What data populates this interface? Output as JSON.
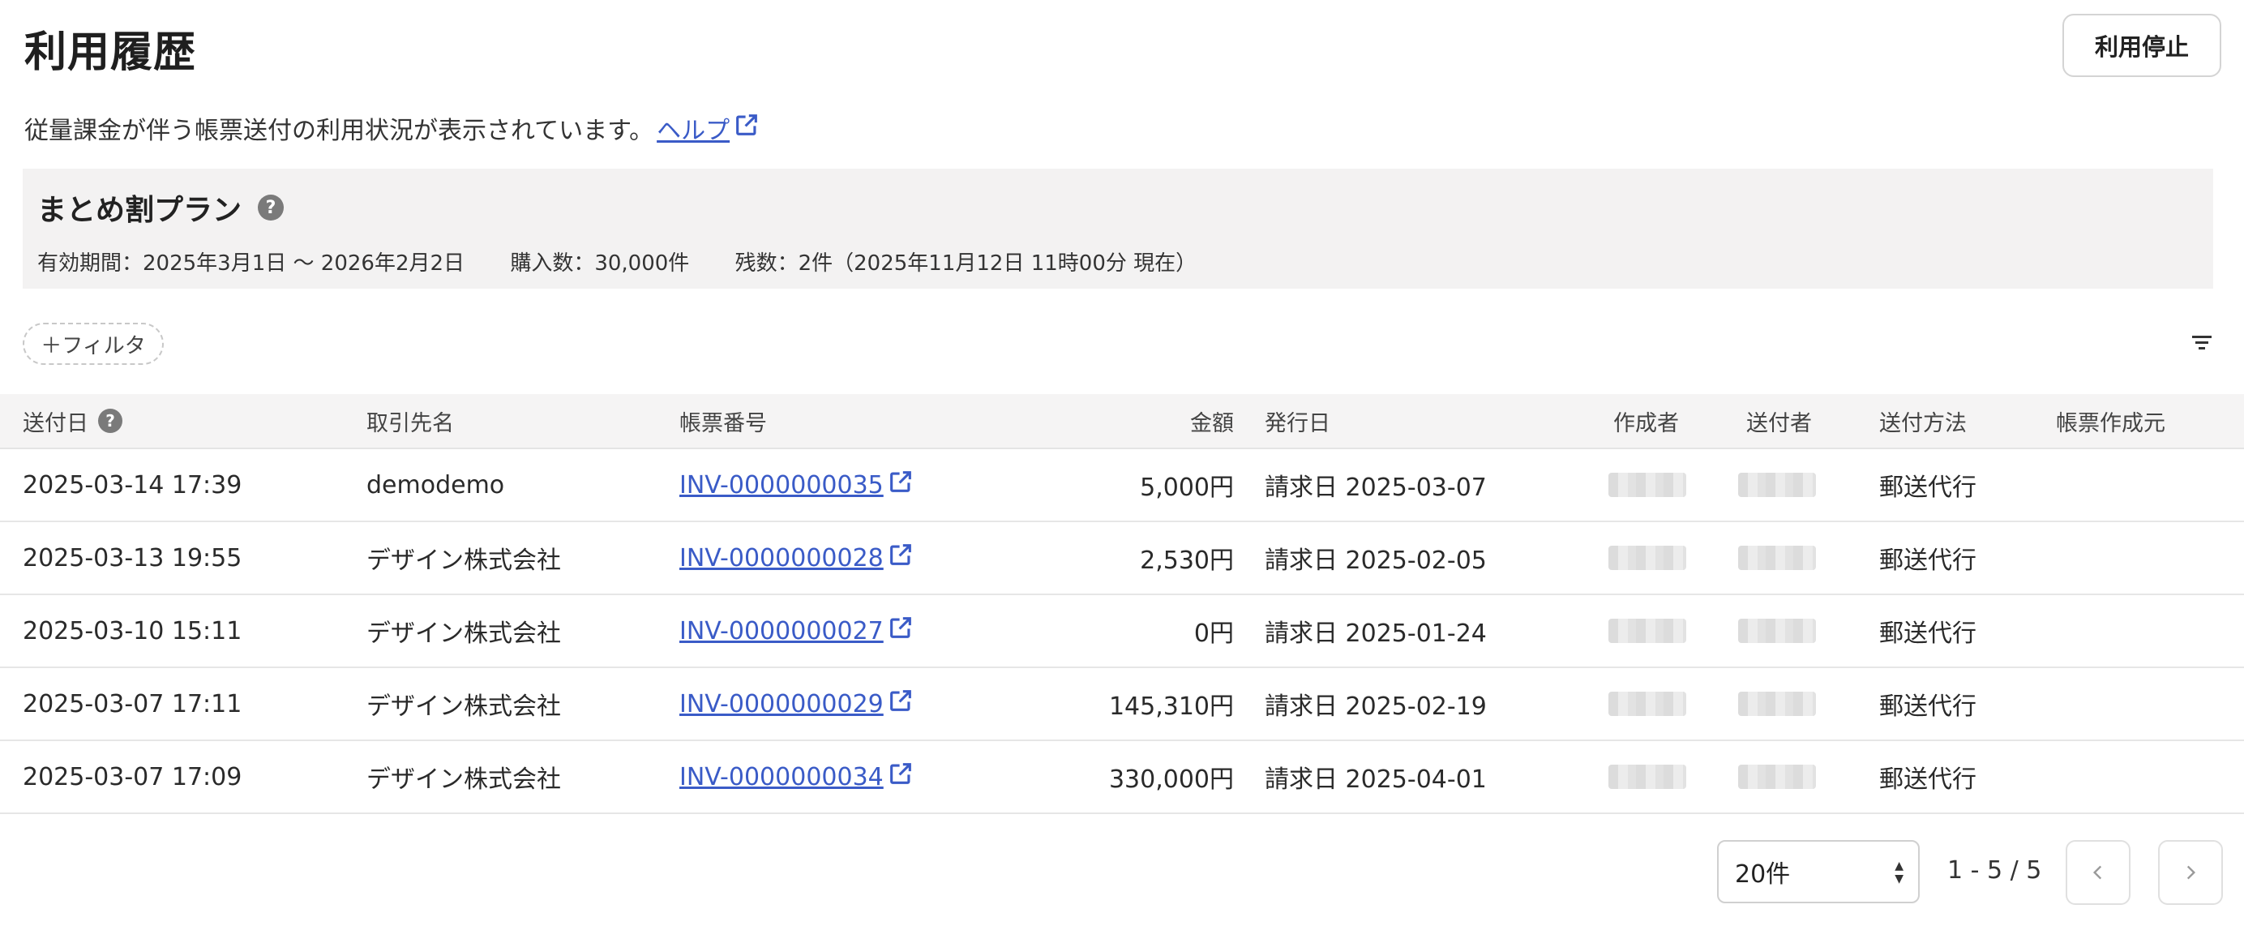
{
  "page": {
    "title": "利用履歴",
    "stop_button": "利用停止",
    "description": "従量課金が伴う帳票送付の利用状況が表示されています。",
    "help_link": "ヘルプ"
  },
  "plan": {
    "name": "まとめ割プラン",
    "help_icon": "?",
    "validity": "有効期間：2025年3月1日 〜 2026年2月2日",
    "purchased": "購入数：30,000件",
    "remaining": "残数：2件（2025年11月12日 11時00分 現在）"
  },
  "filter": {
    "chip_label": "＋フィルタ",
    "icon": "filter-icon"
  },
  "table": {
    "headers": {
      "sent_date": "送付日",
      "sent_date_help": "?",
      "client": "取引先名",
      "invoice_no": "帳票番号",
      "amount": "金額",
      "issue_date": "発行日",
      "creator": "作成者",
      "sender": "送付者",
      "method": "送付方法",
      "origin": "帳票作成元"
    },
    "rows": [
      {
        "sent_date": "2025-03-14 17:39",
        "client": "demodemo",
        "invoice_no": "INV-0000000035",
        "amount": "5,000円",
        "issue_date": "請求日 2025-03-07",
        "method": "郵送代行",
        "origin": ""
      },
      {
        "sent_date": "2025-03-13 19:55",
        "client": "デザイン株式会社",
        "invoice_no": "INV-0000000028",
        "amount": "2,530円",
        "issue_date": "請求日 2025-02-05",
        "method": "郵送代行",
        "origin": ""
      },
      {
        "sent_date": "2025-03-10 15:11",
        "client": "デザイン株式会社",
        "invoice_no": "INV-0000000027",
        "amount": "0円",
        "issue_date": "請求日 2025-01-24",
        "method": "郵送代行",
        "origin": ""
      },
      {
        "sent_date": "2025-03-07 17:11",
        "client": "デザイン株式会社",
        "invoice_no": "INV-0000000029",
        "amount": "145,310円",
        "issue_date": "請求日 2025-02-19",
        "method": "郵送代行",
        "origin": ""
      },
      {
        "sent_date": "2025-03-07 17:09",
        "client": "デザイン株式会社",
        "invoice_no": "INV-0000000034",
        "amount": "330,000円",
        "issue_date": "請求日 2025-04-01",
        "method": "郵送代行",
        "origin": ""
      }
    ]
  },
  "pagination": {
    "per_page": "20件",
    "range": "1 - 5 / 5",
    "prev_icon": "chevron-left-icon",
    "next_icon": "chevron-right-icon"
  },
  "colors": {
    "link": "#3a5bc7",
    "panel_bg": "#f3f2f2",
    "header_bg": "#f5f4f4"
  }
}
